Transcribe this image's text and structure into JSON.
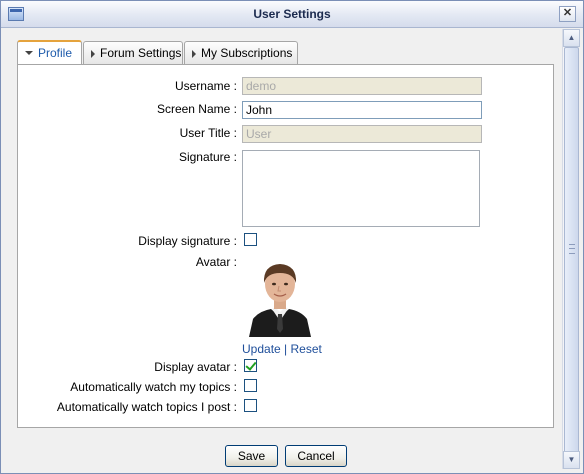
{
  "window": {
    "title": "User Settings"
  },
  "tabs": [
    {
      "label": "Profile",
      "active": true
    },
    {
      "label": "Forum Settings",
      "active": false
    },
    {
      "label": "My Subscriptions",
      "active": false
    }
  ],
  "form": {
    "username": {
      "label": "Username :",
      "value": "demo",
      "enabled": false
    },
    "screen_name": {
      "label": "Screen Name :",
      "value": "John",
      "enabled": true
    },
    "user_title": {
      "label": "User Title :",
      "value": "User",
      "enabled": false
    },
    "signature": {
      "label": "Signature :",
      "value": ""
    },
    "display_signature": {
      "label": "Display signature :",
      "checked": false
    },
    "avatar": {
      "label": "Avatar :",
      "update_label": "Update",
      "separator": "|",
      "reset_label": "Reset"
    },
    "display_avatar": {
      "label": "Display avatar :",
      "checked": true
    },
    "watch_my_topics": {
      "label": "Automatically watch my topics :",
      "checked": false
    },
    "watch_topics_i_post": {
      "label": "Automatically watch topics I post :",
      "checked": false
    }
  },
  "buttons": {
    "save": "Save",
    "cancel": "Cancel"
  },
  "colors": {
    "link": "#1e4e9a",
    "active_tab_accent": "#e5a33d",
    "title_bar": "#dbe2f0"
  }
}
